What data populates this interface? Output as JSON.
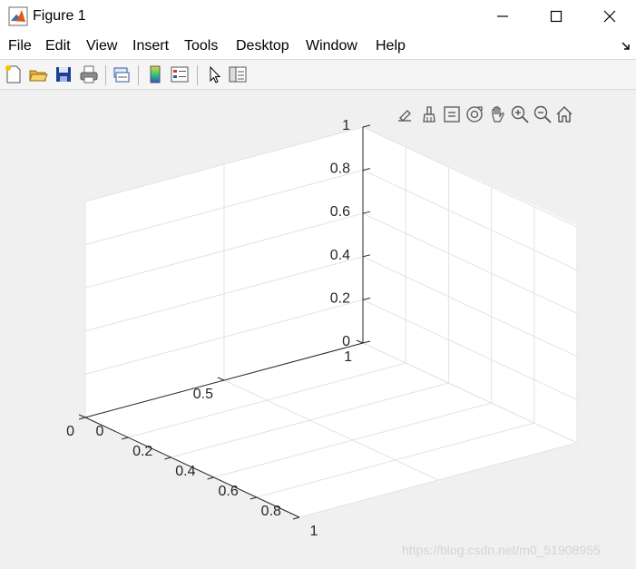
{
  "window": {
    "title": "Figure 1",
    "app_icon": "matlab-icon",
    "controls": [
      "minimize-icon",
      "maximize-icon",
      "close-icon"
    ]
  },
  "menu": {
    "items": [
      "File",
      "Edit",
      "View",
      "Insert",
      "Tools",
      "Desktop",
      "Window",
      "Help"
    ],
    "dock_arrow": "dock-arrow-icon"
  },
  "toolbar": {
    "buttons": [
      "new-figure-icon",
      "open-file-icon",
      "save-icon",
      "print-icon",
      "link-plot-icon",
      "colorbar-icon",
      "legend-icon",
      "edit-plot-icon",
      "property-inspector-icon"
    ]
  },
  "axes_toolbar": {
    "buttons": [
      "brush-edit-icon",
      "data-brush-icon",
      "data-tips-icon",
      "rotate-3d-icon",
      "pan-icon",
      "zoom-in-icon",
      "zoom-out-icon",
      "home-icon"
    ]
  },
  "chart_data": {
    "type": "scatter",
    "title": "",
    "xlabel": "",
    "ylabel": "",
    "zlabel": "",
    "view": "3d",
    "grid": true,
    "xlim": [
      0,
      1
    ],
    "ylim": [
      0,
      1
    ],
    "zlim": [
      0,
      1
    ],
    "x_ticks": [
      "0",
      "0.2",
      "0.4",
      "0.6",
      "0.8",
      "1"
    ],
    "y_ticks": [
      "0",
      "0.5",
      "1"
    ],
    "z_ticks": [
      "0",
      "0.2",
      "0.4",
      "0.6",
      "0.8",
      "1"
    ],
    "series": []
  },
  "watermark": "https://blog.csdn.net/m0_51908955"
}
